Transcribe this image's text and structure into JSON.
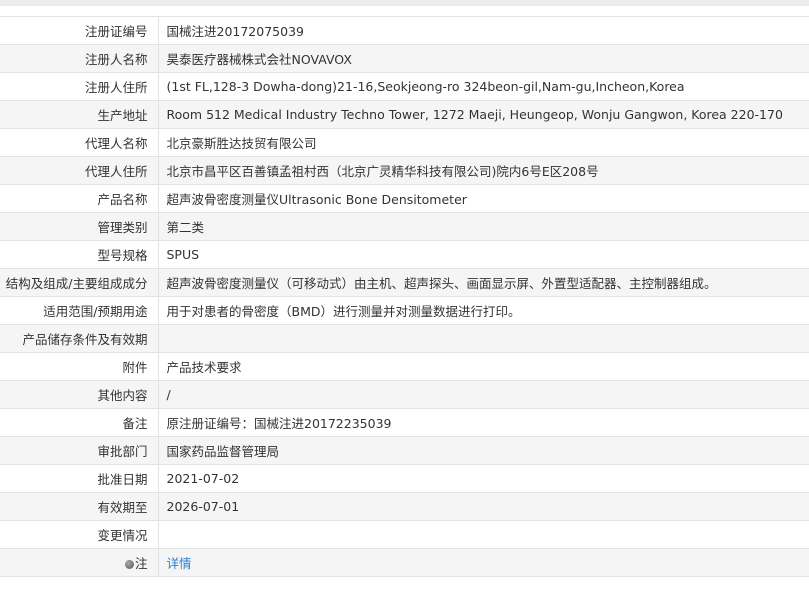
{
  "rows": [
    {
      "label": "注册证编号",
      "value": "国械注进20172075039"
    },
    {
      "label": "注册人名称",
      "value": "昊泰医疗器械株式会社NOVAVOX"
    },
    {
      "label": "注册人住所",
      "value": "(1st FL,128-3 Dowha-dong)21-16,Seokjeong-ro 324beon-gil,Nam-gu,Incheon,Korea"
    },
    {
      "label": "生产地址",
      "value": "Room 512 Medical Industry Techno Tower, 1272 Maeji, Heungeop, Wonju Gangwon, Korea 220-170"
    },
    {
      "label": "代理人名称",
      "value": "北京豪斯胜达技贸有限公司"
    },
    {
      "label": "代理人住所",
      "value": "北京市昌平区百善镇孟祖村西（北京广灵精华科技有限公司)院内6号E区208号"
    },
    {
      "label": "产品名称",
      "value": "超声波骨密度测量仪Ultrasonic Bone Densitometer"
    },
    {
      "label": "管理类别",
      "value": "第二类"
    },
    {
      "label": "型号规格",
      "value": "SPUS"
    },
    {
      "label": "结构及组成/主要组成成分",
      "value": "超声波骨密度测量仪（可移动式）由主机、超声探头、画面显示屏、外置型适配器、主控制器组成。"
    },
    {
      "label": "适用范围/预期用途",
      "value": "用于对患者的骨密度（BMD）进行测量并对测量数据进行打印。"
    },
    {
      "label": "产品储存条件及有效期",
      "value": ""
    },
    {
      "label": "附件",
      "value": "产品技术要求"
    },
    {
      "label": "其他内容",
      "value": "/"
    },
    {
      "label": "备注",
      "value": "原注册证编号：国械注进20172235039"
    },
    {
      "label": "审批部门",
      "value": "国家药品监督管理局"
    },
    {
      "label": "批准日期",
      "value": "2021-07-02"
    },
    {
      "label": "有效期至",
      "value": "2026-07-01"
    },
    {
      "label": "变更情况",
      "value": ""
    }
  ],
  "note": {
    "label": "注",
    "link": "详情",
    "icon": "bulb-icon"
  },
  "colors": {
    "link": "#2a7fd1",
    "alt_row": "#f5f5f5",
    "border": "#e3e3e3"
  }
}
